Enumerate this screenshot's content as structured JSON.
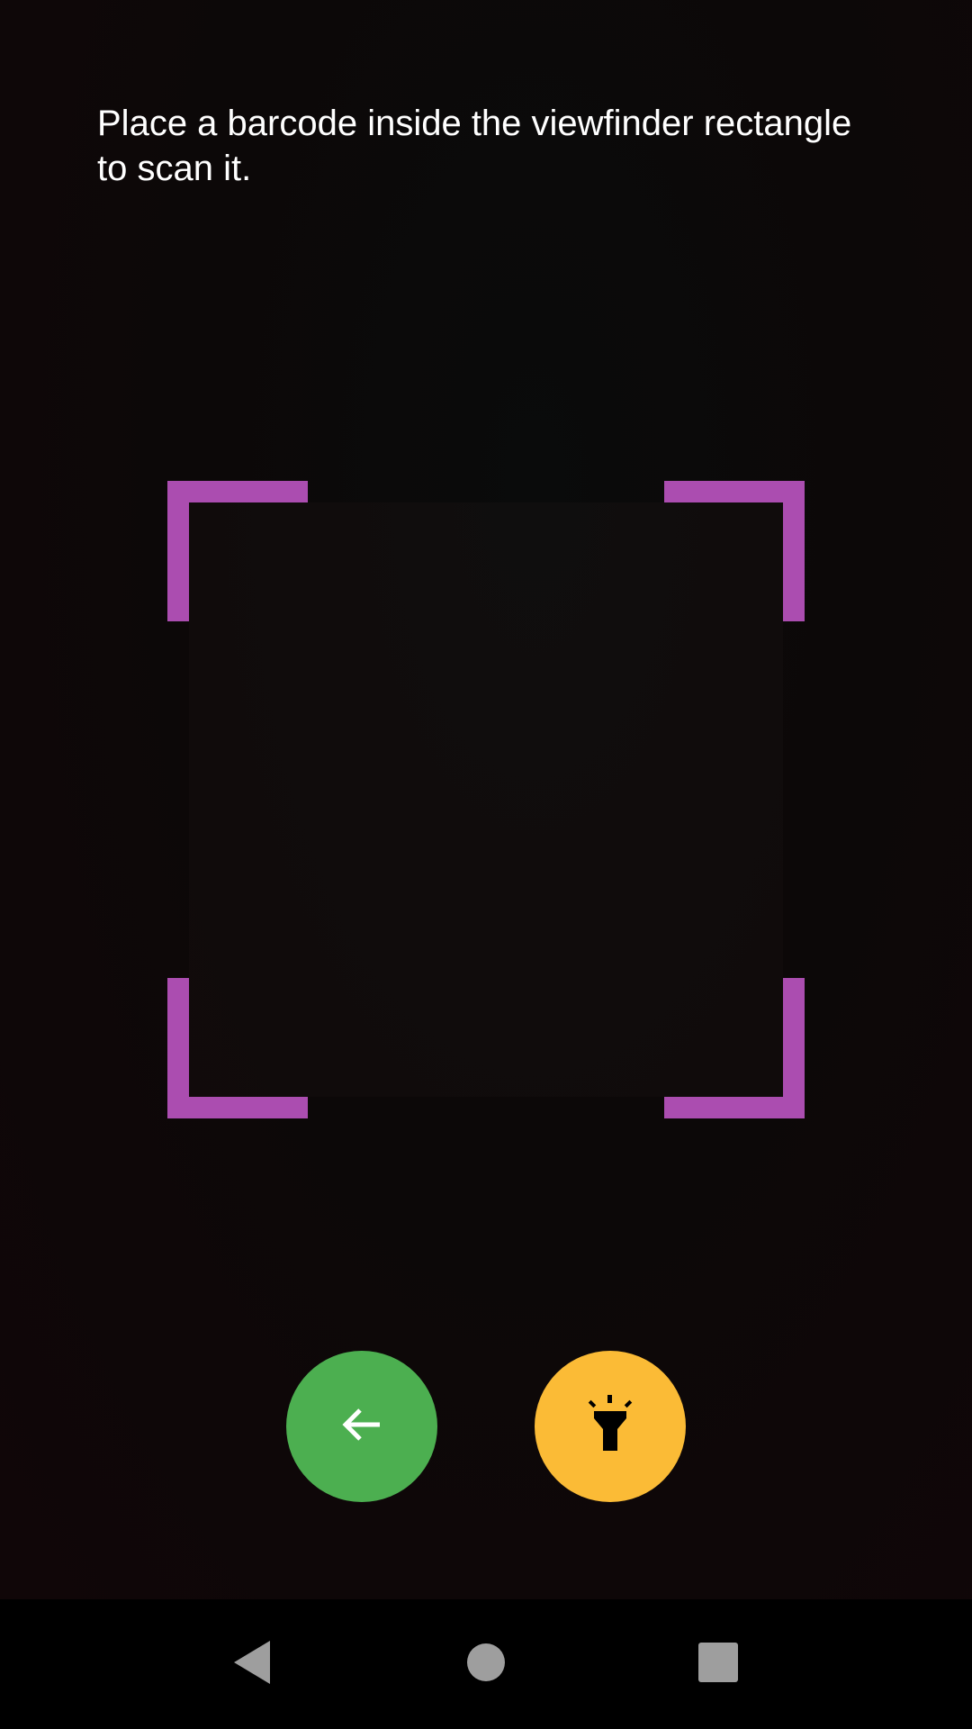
{
  "scanner": {
    "instruction": "Place a barcode inside the viewfinder rectangle to scan it."
  },
  "colors": {
    "viewfinder_corner": "#ab4db0",
    "back_button": "#4caf50",
    "flash_button": "#fbbb36",
    "nav_icon": "#9e9e9e"
  },
  "buttons": {
    "back_icon": "arrow-left-icon",
    "flash_icon": "flashlight-icon"
  },
  "navbar": {
    "back_icon": "nav-back-triangle-icon",
    "home_icon": "nav-home-circle-icon",
    "recent_icon": "nav-recents-square-icon"
  }
}
